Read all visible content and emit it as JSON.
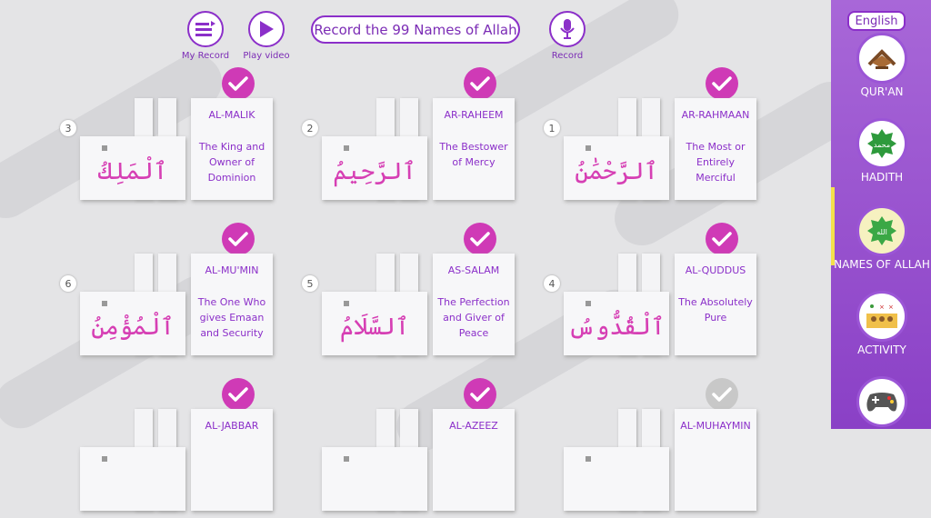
{
  "toolbar": {
    "my_record_label": "My Record",
    "play_video_label": "Play video",
    "record_title": "Record the 99 Names of Allah",
    "record_label": "Record"
  },
  "sidebar": {
    "language": "English",
    "items": [
      {
        "label": "QUR'AN",
        "icon": "quran-icon"
      },
      {
        "label": "HADITH",
        "icon": "hadith-icon"
      },
      {
        "label": "NAMES OF ALLAH",
        "icon": "allah-icon"
      },
      {
        "label": "ACTIVITY",
        "icon": "activity-icon"
      },
      {
        "label": "",
        "icon": "gamepad-icon"
      }
    ]
  },
  "cards": [
    {
      "num": "3",
      "arabic": "ٱلْمَلِكُ",
      "name": "AL-MALIK",
      "meaning": "The King and Owner of Dominion",
      "checked": true
    },
    {
      "num": "2",
      "arabic": "ٱلرَّحِيمُ",
      "name": "AR-RAHEEM",
      "meaning": "The Bestower of Mercy",
      "checked": true
    },
    {
      "num": "1",
      "arabic": "ٱلرَّحْمَٰنُ",
      "name": "AR-RAHMAAN",
      "meaning": "The Most or Entirely Merciful",
      "checked": true
    },
    {
      "num": "6",
      "arabic": "ٱلْمُؤْمِنُ",
      "name": "AL-MU'MIN",
      "meaning": "The One Who gives Emaan and Security",
      "checked": true
    },
    {
      "num": "5",
      "arabic": "ٱلسَّلَامُ",
      "name": "AS-SALAM",
      "meaning": "The Perfection and Giver of Peace",
      "checked": true
    },
    {
      "num": "4",
      "arabic": "ٱلْقُدُّوسُ",
      "name": "AL-QUDDUS",
      "meaning": "The Absolutely Pure",
      "checked": true
    },
    {
      "num": "",
      "arabic": "",
      "name": "AL-JABBAR",
      "meaning": "",
      "checked": true
    },
    {
      "num": "",
      "arabic": "",
      "name": "AL-AZEEZ",
      "meaning": "",
      "checked": true
    },
    {
      "num": "",
      "arabic": "",
      "name": "AL-MUHAYMIN",
      "meaning": "",
      "checked": false
    }
  ]
}
